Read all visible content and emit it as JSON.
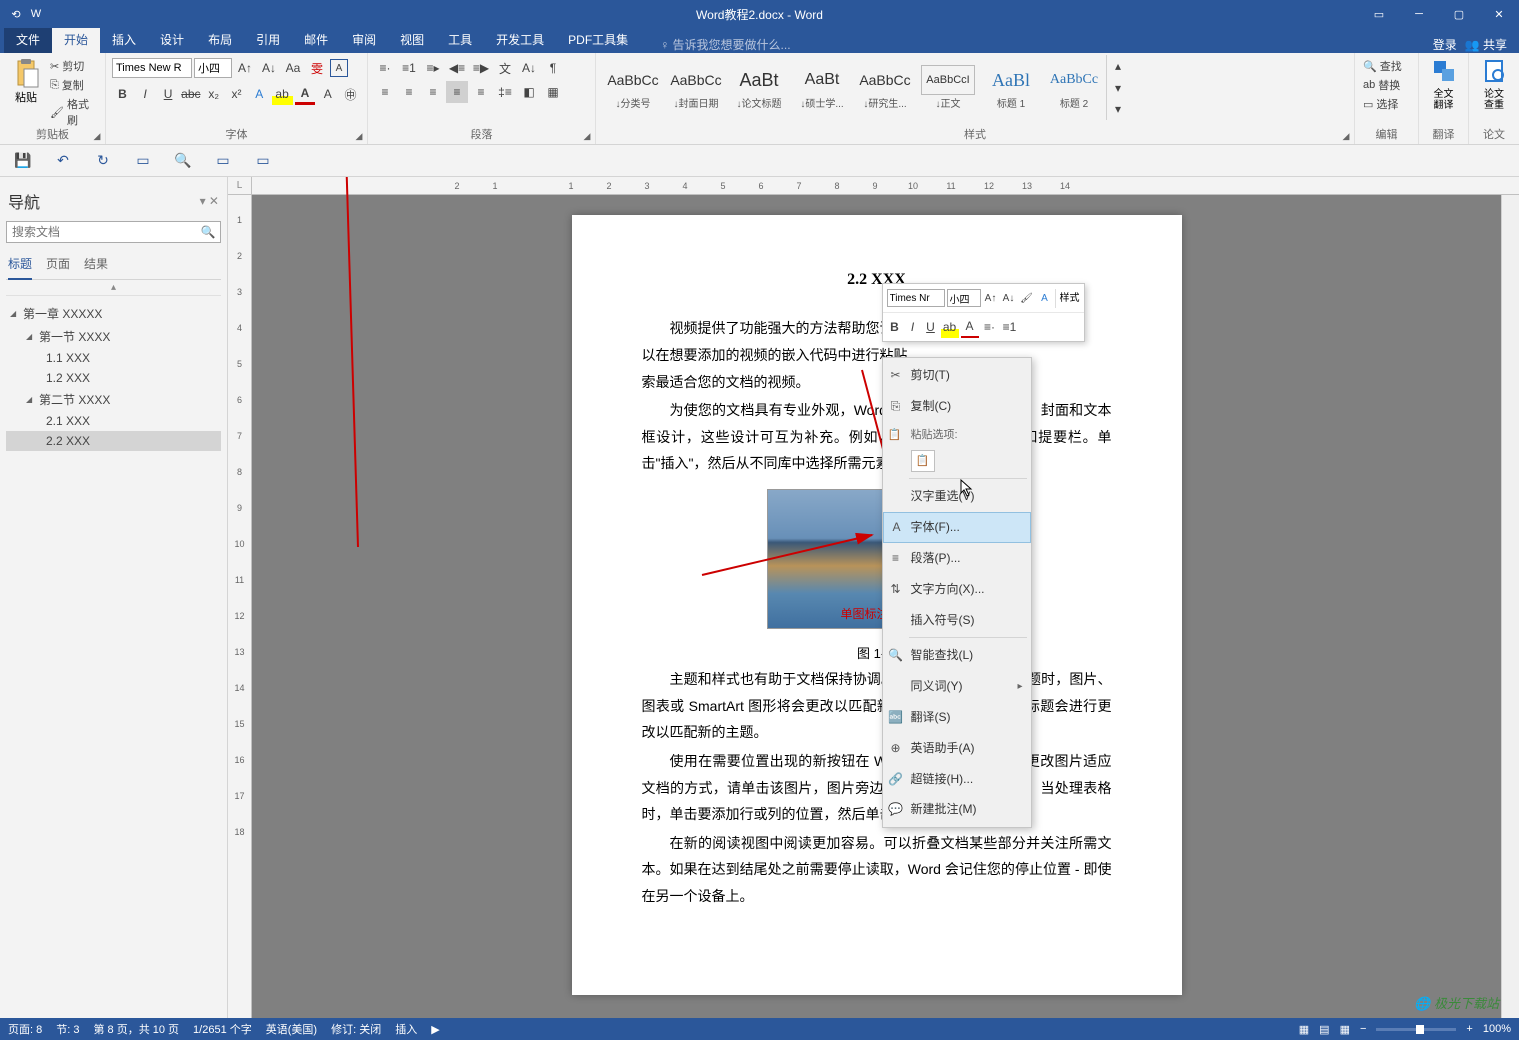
{
  "title": "Word教程2.docx - Word",
  "ribbon_tabs": {
    "file": "文件",
    "home": "开始",
    "insert": "插入",
    "design": "设计",
    "layout": "布局",
    "references": "引用",
    "mailings": "邮件",
    "review": "审阅",
    "view": "视图",
    "tools": "工具",
    "developer": "开发工具",
    "pdf": "PDF工具集",
    "tell_me": "告诉我您想要做什么...",
    "login": "登录",
    "share": "共享"
  },
  "clipboard": {
    "paste": "粘贴",
    "cut": "剪切",
    "copy": "复制",
    "format_painter": "格式刷",
    "group": "剪贴板"
  },
  "font": {
    "name": "Times New R",
    "size": "小四",
    "group": "字体"
  },
  "paragraph": {
    "group": "段落"
  },
  "styles": {
    "group": "样式",
    "preview": "AaBbCc",
    "preview2": "AaBt",
    "preview3": "AaBl",
    "items": [
      {
        "label": "↓分类号"
      },
      {
        "label": "↓封面日期"
      },
      {
        "label": "↓论文标题"
      },
      {
        "label": "↓硕士学..."
      },
      {
        "label": "↓研究生..."
      },
      {
        "label": "↓正文"
      },
      {
        "label": "标题 1"
      },
      {
        "label": "标题 2"
      }
    ]
  },
  "editing": {
    "find": "查找",
    "replace": "替换",
    "select": "选择",
    "group": "编辑"
  },
  "translate": {
    "full": "全文翻译",
    "group": "翻译"
  },
  "thesis": {
    "check": "论文查重",
    "group": "论文"
  },
  "nav": {
    "title": "导航",
    "search_placeholder": "搜索文档",
    "tabs": {
      "headings": "标题",
      "pages": "页面",
      "results": "结果"
    },
    "tree": [
      {
        "level": 1,
        "text": "第一章 XXXXX",
        "expand": true
      },
      {
        "level": 2,
        "text": "第一节 XXXX",
        "expand": true
      },
      {
        "level": 3,
        "text": "1.1 XXX"
      },
      {
        "level": 3,
        "text": "1.2 XXX"
      },
      {
        "level": 2,
        "text": "第二节 XXXX",
        "expand": true
      },
      {
        "level": 3,
        "text": "2.1 XXX"
      },
      {
        "level": 3,
        "text": "2.2 XXX",
        "selected": true
      }
    ]
  },
  "doc": {
    "heading": "2.2 XXX",
    "p1a": "视频提供了功能强大的方法帮助您证明",
    "p1b": "以在想要添加的视频的嵌入代码中进行粘贴",
    "p1c": "索最适合您的文档的视频。",
    "p2a": "为使您的文档具有专业外观，Word",
    "p2ref": "[1]",
    "p2b": "提供了页眉、页脚、封面和文本框设计，这些设计可互为补充。例如，您可以添",
    "p2c": "眉和提要栏。单击\"插入\"，然后从不同库中选择所需元素。",
    "caption": "图 1- 1",
    "red_label": "单图标注文字",
    "p3": "主题和样式也有助于文档保持协调。当",
    "p3b": "新的主题时，图片、图表或 SmartArt 图形将会更改以匹配新的",
    "p3c": "时，您的标题会进行更改以匹配新的主题。",
    "p4": "使用在需要位置出现的新按钮在 Word 中保存时间。若要更改图片适应文档的方式，请单击该图片，图片旁边将会显示布局选项按钮。当处理表格时，单击要添加行或列的位置，然后单击加号。",
    "p5": "在新的阅读视图中阅读更加容易。可以折叠文档某些部分并关注所需文本。如果在达到结尾处之前需要停止读取，Word 会记住您的停止位置 - 即使在另一个设备上。"
  },
  "mini": {
    "font": "Times Nr",
    "size": "小四",
    "styles": "样式"
  },
  "context": {
    "cut": "剪切(T)",
    "copy": "复制(C)",
    "paste_opts": "粘贴选项:",
    "hanzi": "汉字重选(V)",
    "font": "字体(F)...",
    "paragraph": "段落(P)...",
    "text_dir": "文字方向(X)...",
    "insert_symbol": "插入符号(S)",
    "smart_lookup": "智能查找(L)",
    "synonyms": "同义词(Y)",
    "translate": "翻译(S)",
    "english_assist": "英语助手(A)",
    "hyperlink": "超链接(H)...",
    "new_comment": "新建批注(M)"
  },
  "status": {
    "page": "页面: 8",
    "section": "节: 3",
    "page_of": "第 8 页，共 10 页",
    "words": "1/2651 个字",
    "lang": "英语(美国)",
    "track": "修订: 关闭",
    "insert": "插入",
    "zoom": "100%"
  },
  "watermark": "极光下载站"
}
